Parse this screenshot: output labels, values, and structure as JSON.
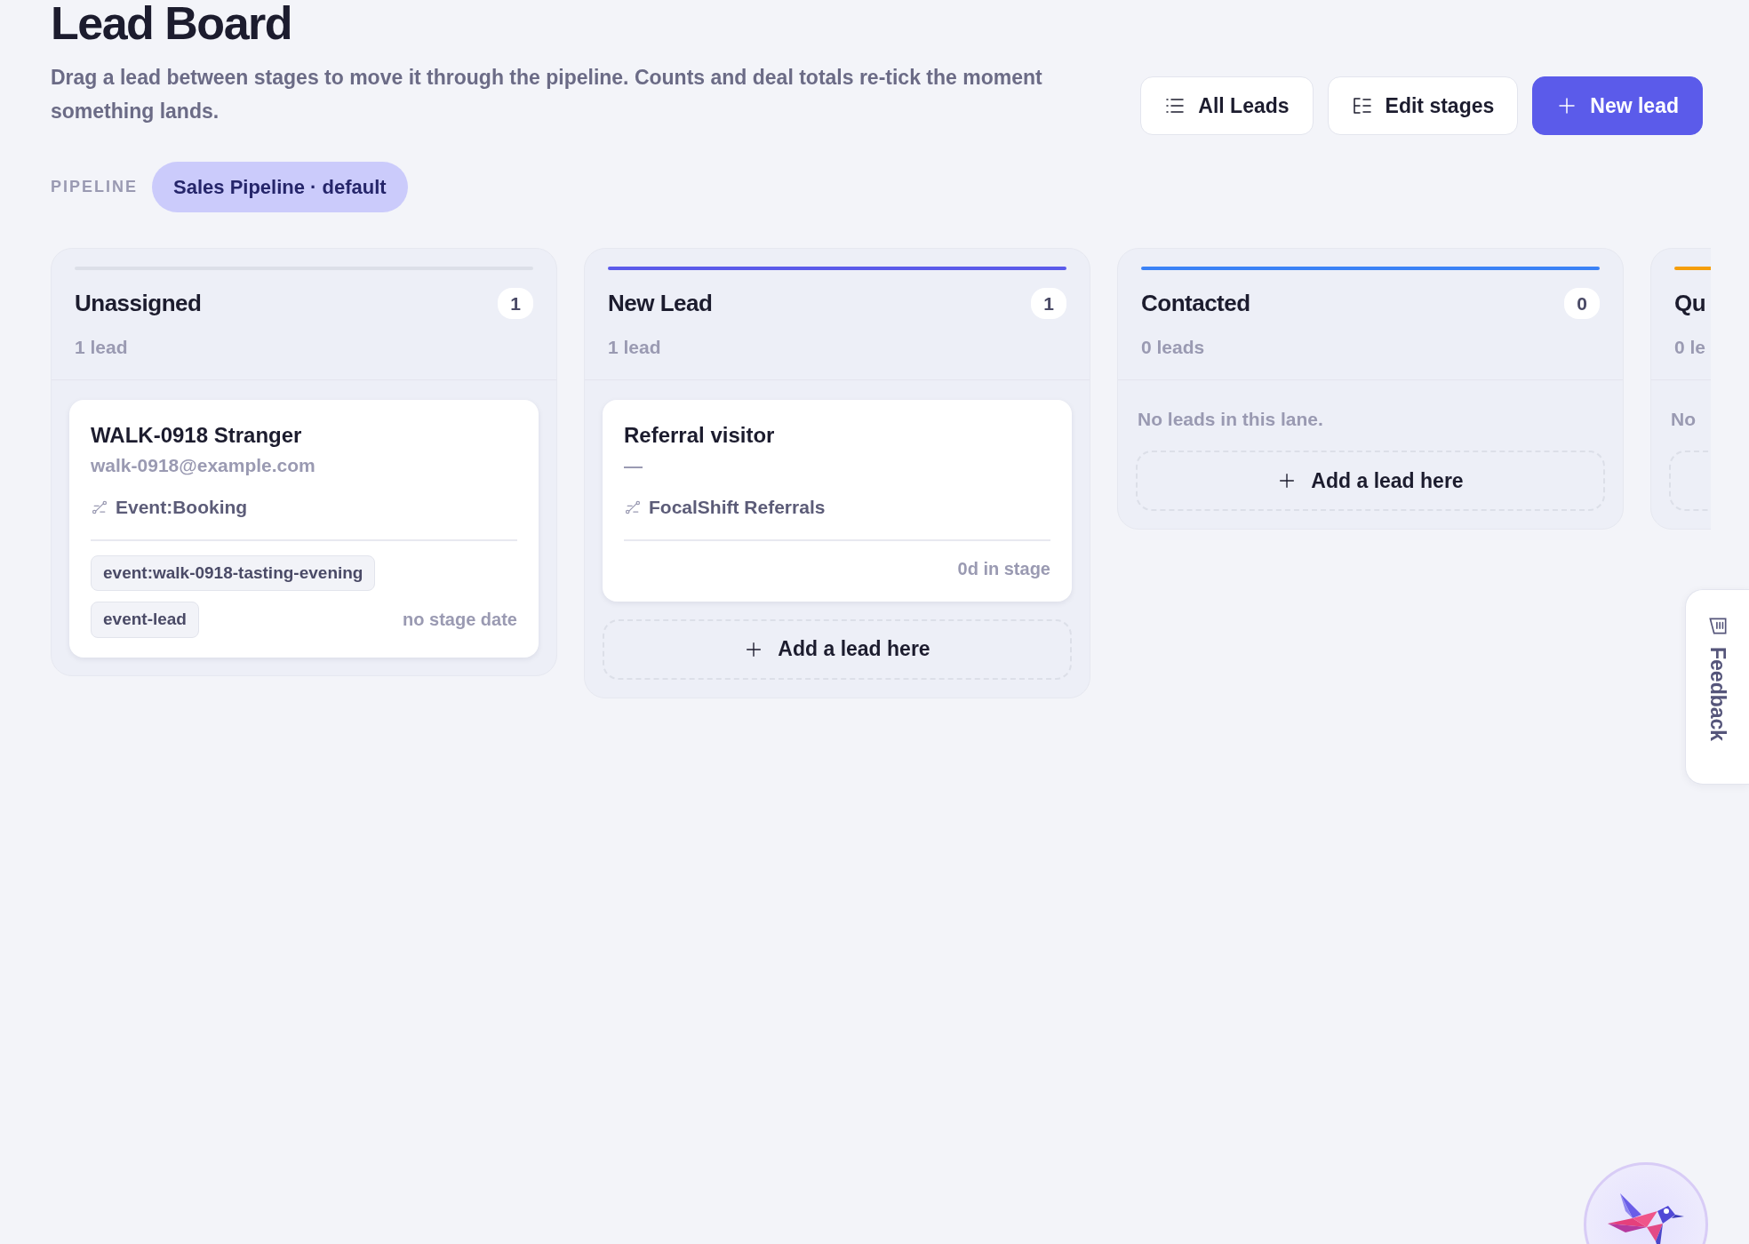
{
  "page": {
    "title": "Lead Board",
    "description": "Drag a lead between stages to move it through the pipeline. Counts and deal totals re-tick the moment something lands."
  },
  "actions": [
    {
      "label": "All Leads",
      "kind": "list",
      "primary": false
    },
    {
      "label": "Edit stages",
      "kind": "stages",
      "primary": false
    },
    {
      "label": "New lead",
      "kind": "add",
      "primary": true
    }
  ],
  "pipeline": {
    "label": "PIPELINE",
    "value": "Sales Pipeline · default"
  },
  "lanes": [
    {
      "title": "Unassigned",
      "count": "1",
      "subtitle": "1 lead",
      "color": "#dcdfe8",
      "cards": [
        {
          "name": "WALK-0918 Stranger",
          "email": "walk-0918@example.com",
          "source": "Event:Booking",
          "tags": [
            "event:walk-0918-tasting-evening",
            "event-lead"
          ],
          "footer": "no stage date"
        }
      ]
    },
    {
      "title": "New Lead",
      "count": "1",
      "subtitle": "1 lead",
      "color": "#5b5bea",
      "cards": [
        {
          "name": "Referral visitor",
          "email": "—",
          "source": "FocalShift Referrals",
          "footer": "0d in stage"
        }
      ],
      "add_label": "Add a lead here"
    },
    {
      "title": "Contacted",
      "count": "0",
      "subtitle": "0 leads",
      "color": "#3b82f6",
      "empty_text": "No leads in this lane.",
      "add_label": "Add a lead here"
    },
    {
      "title": "Qu",
      "subtitle": "0 le",
      "color": "#f59e0b",
      "empty_text": "No",
      "add_box": true
    }
  ],
  "feedback": {
    "label": "Feedback"
  }
}
